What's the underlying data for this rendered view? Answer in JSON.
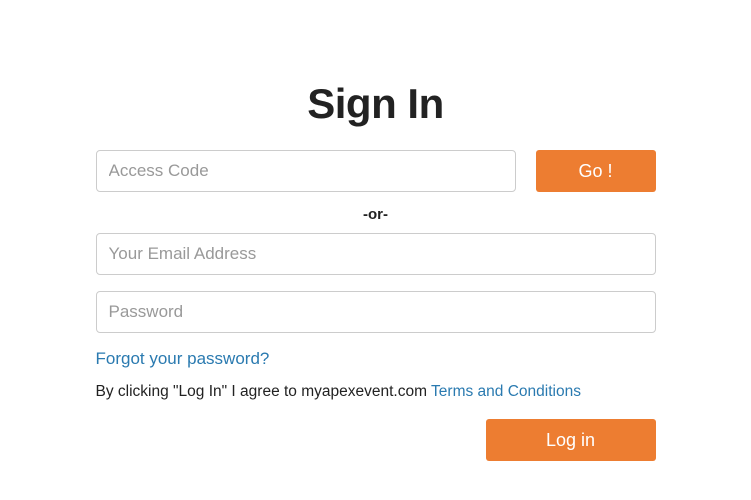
{
  "title": "Sign In",
  "access": {
    "placeholder": "Access Code",
    "go_label": "Go !"
  },
  "separator": "-or-",
  "email": {
    "placeholder": "Your Email Address"
  },
  "password": {
    "placeholder": "Password"
  },
  "forgot_label": "Forgot your password?",
  "agree": {
    "prefix": "By clicking \"Log In\" I agree to myapexevent.com ",
    "terms_label": "Terms and Conditions"
  },
  "login_label": "Log in"
}
